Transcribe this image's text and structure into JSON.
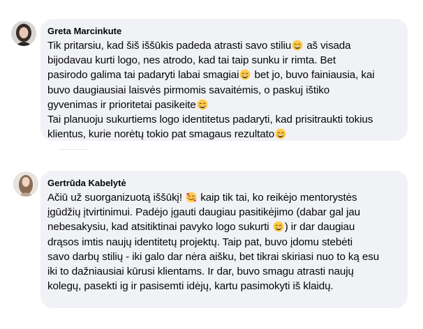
{
  "comments": [
    {
      "author": "Greta Marcinkute",
      "lines": [
        [
          "Tik pritarsiu, kad šiš iššūkis padeda atrasti savo stiliu",
          "grin",
          " aš visada"
        ],
        [
          "bijodavau kurti logo, nes atrodo, kad tai taip sunku ir rimta. Bet"
        ],
        [
          "pasirodo galima tai padaryti labai smagiai",
          "grin",
          " bet jo, buvo fainiausia, kai"
        ],
        [
          "buvo daugiausiai laisvės pirmomis savaitėmis, o paskuj ištiko"
        ],
        [
          "gyvenimas ir prioritetai pasikeite",
          "grin"
        ],
        [
          "Tai planuoju sukurtiems logo identitetus padaryti, kad prisitraukti tokius"
        ],
        [
          "klientus, kurie norėtų tokio pat smagaus rezultato",
          "grin"
        ]
      ]
    },
    {
      "author": "Gertrūda Kabelytė",
      "lines": [
        [
          "Ačiū už suorganizuotą iššūkį! ",
          "hearts",
          " kaip tik tai, ko reikėjo mentorystės"
        ],
        [
          "įgūdžių įtvirtinimui. Padėjo įgauti daugiau pasitikėjimo (dabar gal jau"
        ],
        [
          "nebesakysiu, kad atsitiktinai pavyko logo sukurti ",
          "grin",
          ") ir dar daugiau"
        ],
        [
          "drąsos imtis naujų identitetų projektų. Taip pat, buvo įdomu stebėti"
        ],
        [
          "savo darbų stilių - iki galo dar nėra aišku, bet tikrai skiriasi nuo to ką esu"
        ],
        [
          "iki to dažniausiai kūrusi klientams. Ir dar, buvo smagu atrasti naujų"
        ],
        [
          "kolegų, pasekti ig ir pasisemti idėjų, kartu pasimokyti iš klaidų."
        ]
      ]
    }
  ],
  "icons": {
    "grin": "grinning-face-with-smiling-eyes-icon",
    "hearts": "smiling-face-with-hearts-icon"
  },
  "colors": {
    "bubble": "#f0f2f5",
    "text": "#050505",
    "emoji_face": "#ffcc4d",
    "heart": "#e8384f"
  }
}
